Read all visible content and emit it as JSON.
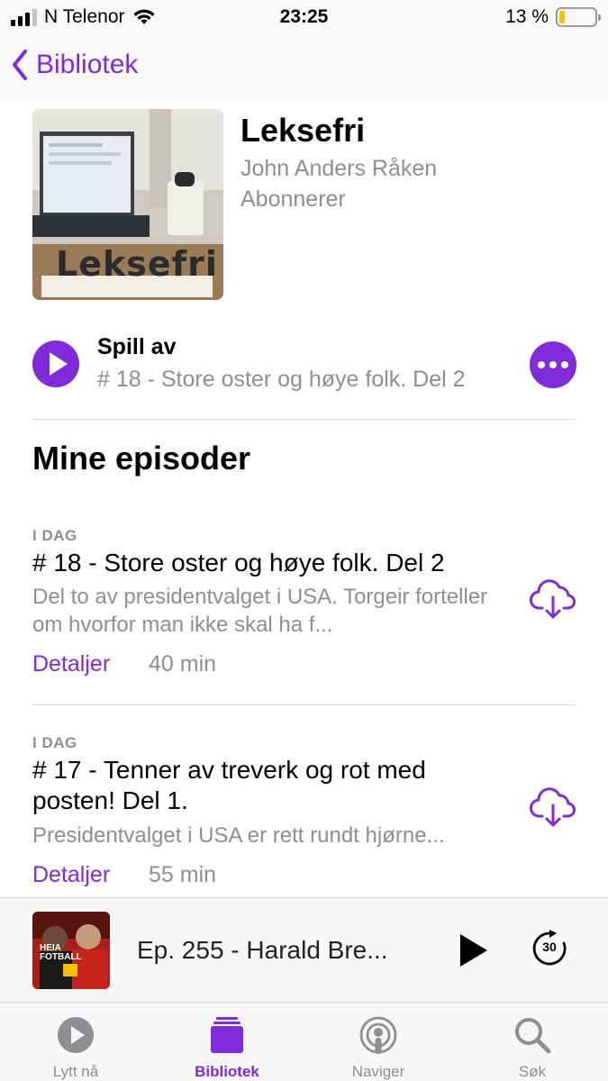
{
  "status_bar": {
    "carrier": "N Telenor",
    "time": "23:25",
    "battery": "13 %",
    "battery_level": 0.13
  },
  "nav": {
    "back_label": "Bibliotek"
  },
  "podcast": {
    "artwork_text": "Leksefri",
    "title": "Leksefri",
    "author": "John Anders Råken",
    "subscription_status": "Abonnerer"
  },
  "play_section": {
    "label": "Spill av",
    "episode": "# 18 - Store oster og høye folk. Del 2"
  },
  "section_title": "Mine episoder",
  "episodes": [
    {
      "date": "I DAG",
      "title": "# 18 - Store oster og høye folk. Del 2",
      "description": "Del to av presidentvalget i USA. Torgeir forteller om hvorfor man ikke skal ha f...",
      "details_label": "Detaljer",
      "duration": "40 min"
    },
    {
      "date": "I DAG",
      "title": "# 17 - Tenner av treverk og rot med posten! Del 1.",
      "description": "Presidentvalget i USA er rett rundt hjørne...",
      "details_label": "Detaljer",
      "duration": "55 min"
    }
  ],
  "mini_player": {
    "artwork_text": "HEIA FOTBALL",
    "title": "Ep. 255 - Harald Bre...",
    "skip_seconds": "30"
  },
  "tabs": [
    {
      "label": "Lytt nå",
      "icon": "play-circle-icon",
      "active": false
    },
    {
      "label": "Bibliotek",
      "icon": "library-icon",
      "active": true
    },
    {
      "label": "Naviger",
      "icon": "podcast-broadcast-icon",
      "active": false
    },
    {
      "label": "Søk",
      "icon": "search-icon",
      "active": false
    }
  ],
  "colors": {
    "accent": "#7f2bd9",
    "secondary_text": "#8e8e93",
    "battery_low": "#f7c600"
  }
}
